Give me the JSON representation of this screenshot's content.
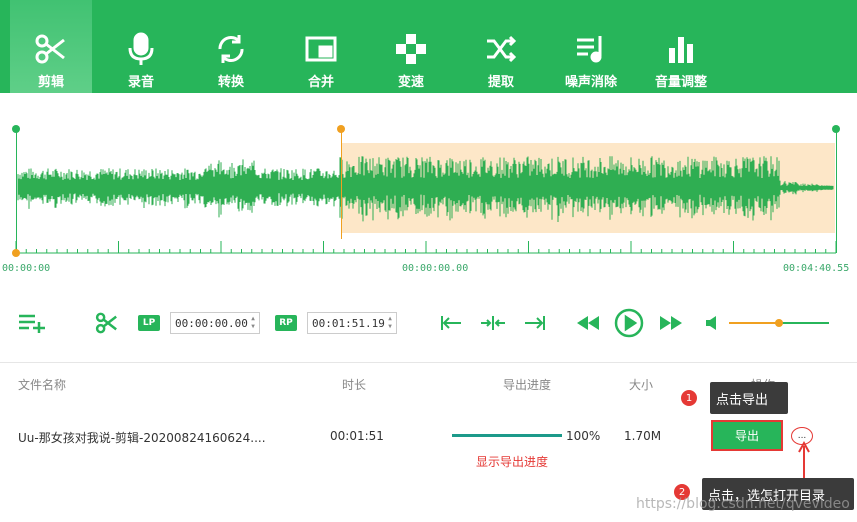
{
  "toolbar": {
    "tools": [
      {
        "label": "剪辑",
        "icon": "scissors-icon",
        "active": true
      },
      {
        "label": "录音",
        "icon": "microphone-icon"
      },
      {
        "label": "转换",
        "icon": "convert-icon"
      },
      {
        "label": "合并",
        "icon": "merge-icon"
      },
      {
        "label": "变速",
        "icon": "speed-icon"
      },
      {
        "label": "提取",
        "icon": "extract-icon"
      },
      {
        "label": "噪声消除",
        "icon": "noise-removal-icon"
      },
      {
        "label": "音量调整",
        "icon": "volume-adjust-icon"
      }
    ]
  },
  "timeline": {
    "start": "00:00:00",
    "cursor": "00:00:00.00",
    "end": "00:04:40.55"
  },
  "controls": {
    "lp_label": "LP",
    "rp_label": "RP",
    "lp_value": "00:00:00.00",
    "rp_value": "00:01:51.19",
    "volume_level": 0.5
  },
  "file_list": {
    "headers": {
      "name": "文件名称",
      "duration": "时长",
      "progress": "导出进度",
      "size": "大小",
      "action": "操作"
    },
    "rows": [
      {
        "name": "Uu-那女孩对我说-剪辑-20200824160624....",
        "duration": "00:01:51",
        "progress_pct": "100%",
        "progress": 1.0,
        "size": "1.70M",
        "export_label": "导出",
        "more_label": "..."
      }
    ]
  },
  "annotations": {
    "show_progress": "显示导出进度",
    "step1_num": "1",
    "step1_text": "点击导出",
    "step2_num": "2",
    "step2_text": "点击，选怎打开目录"
  },
  "watermark": "https://blog.csdn.net/qvevideo",
  "colors": {
    "primary": "#27b55a",
    "selection": "#fde7c8",
    "marker": "#f0a020",
    "annotation": "#e53935"
  }
}
